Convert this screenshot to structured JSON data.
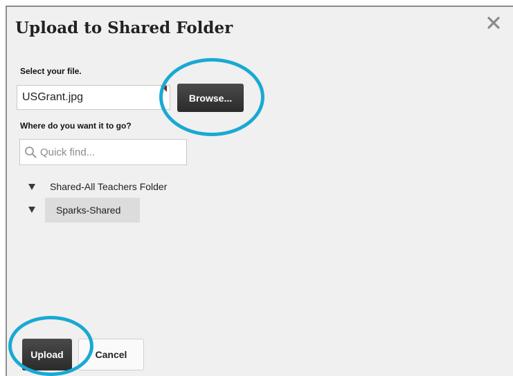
{
  "dialog": {
    "title": "Upload to Shared Folder",
    "close_icon": "close-icon"
  },
  "file_section": {
    "label": "Select your file.",
    "file_name": "USGrant.jpg",
    "browse_label": "Browse..."
  },
  "destination": {
    "label": "Where do you want it to go?",
    "search_placeholder": "Quick find...",
    "search_icon": "search-icon",
    "folders": [
      {
        "label": "Shared-All Teachers Folder",
        "selected": false
      },
      {
        "label": "Sparks-Shared",
        "selected": true
      }
    ]
  },
  "actions": {
    "upload_label": "Upload",
    "cancel_label": "Cancel"
  },
  "colors": {
    "highlight_ring": "#19a9d3",
    "dark_button": "#2b2b2b",
    "selected_row": "#dcdcdc",
    "dialog_background": "#f0f0f0"
  }
}
